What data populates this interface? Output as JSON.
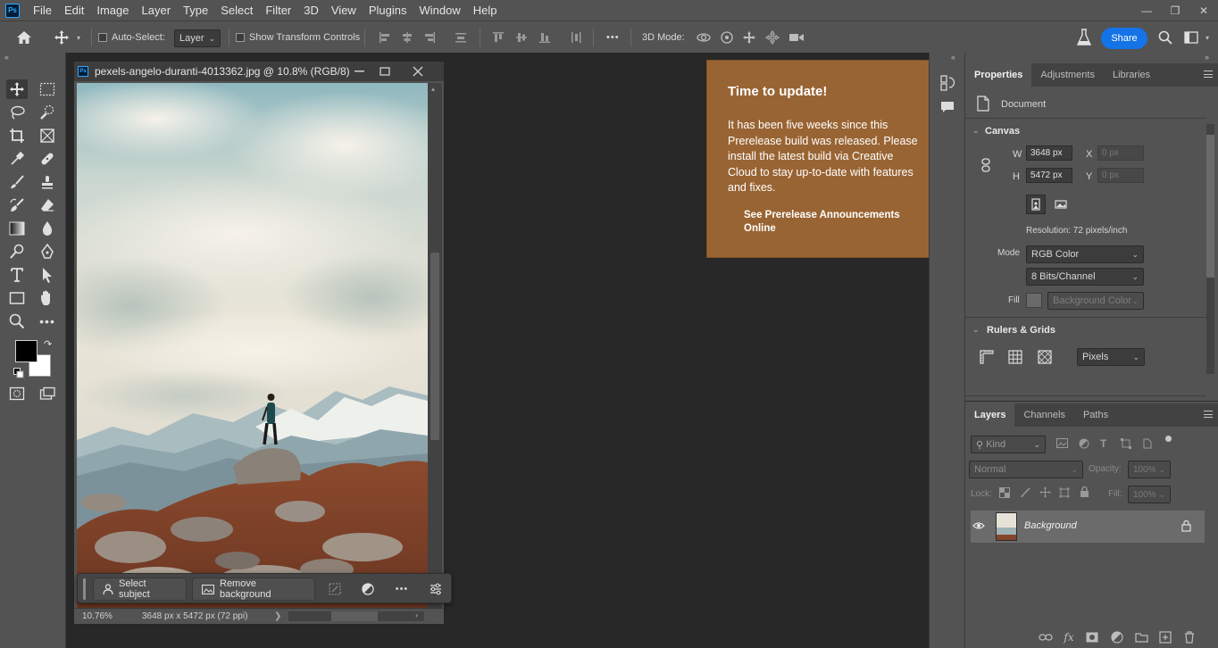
{
  "app": {
    "logo": "Ps",
    "menu": [
      "File",
      "Edit",
      "Image",
      "Layer",
      "Type",
      "Select",
      "Filter",
      "3D",
      "View",
      "Plugins",
      "Window",
      "Help"
    ],
    "window_buttons": {
      "minimize": "—",
      "restore": "❐",
      "close": "✕"
    }
  },
  "options_bar": {
    "auto_select_label": "Auto-Select:",
    "auto_select_target": "Layer",
    "show_transform_label": "Show Transform Controls",
    "more_label": "•••",
    "mode_3d_label": "3D Mode:",
    "share_label": "Share"
  },
  "document": {
    "title": "pexels-angelo-duranti-4013362.jpg @ 10.8% (RGB/8)",
    "zoom": "10.76%",
    "info": "3648 px x 5472 px (72 ppi)",
    "info_arrow": "❯"
  },
  "context_bar": {
    "select_subject": "Select subject",
    "remove_background": "Remove background",
    "more": "•••"
  },
  "update_popup": {
    "title": "Time to update!",
    "body": "It has been five weeks since this Prerelease build was released. Please install the latest build via Creative Cloud to stay up-to-date with features and fixes.",
    "link": "See Prerelease Announcements Online",
    "accent": "#996433"
  },
  "properties": {
    "tabs": [
      "Properties",
      "Adjustments",
      "Libraries"
    ],
    "doc_label": "Document",
    "canvas_heading": "Canvas",
    "w_label": "W",
    "w_value": "3648 px",
    "h_label": "H",
    "h_value": "5472 px",
    "x_label": "X",
    "x_value": "0 px",
    "y_label": "Y",
    "y_value": "0 px",
    "resolution": "Resolution: 72 pixels/inch",
    "mode_label": "Mode",
    "mode_value": "RGB Color",
    "depth_value": "8 Bits/Channel",
    "fill_label": "Fill",
    "fill_value": "Background Color",
    "rulers_heading": "Rulers & Grids",
    "units_value": "Pixels"
  },
  "layers": {
    "tabs": [
      "Layers",
      "Channels",
      "Paths"
    ],
    "kind_placeholder": "Kind",
    "blend_mode": "Normal",
    "opacity_label": "Opacity:",
    "opacity_value": "100%",
    "lock_label": "Lock:",
    "fill_label": "Fill:",
    "fill_value": "100%",
    "layer_name": "Background",
    "fx_label": "fx"
  },
  "colors": {
    "foreground": "#000000",
    "background": "#ffffff",
    "share_blue": "#1473e6"
  }
}
